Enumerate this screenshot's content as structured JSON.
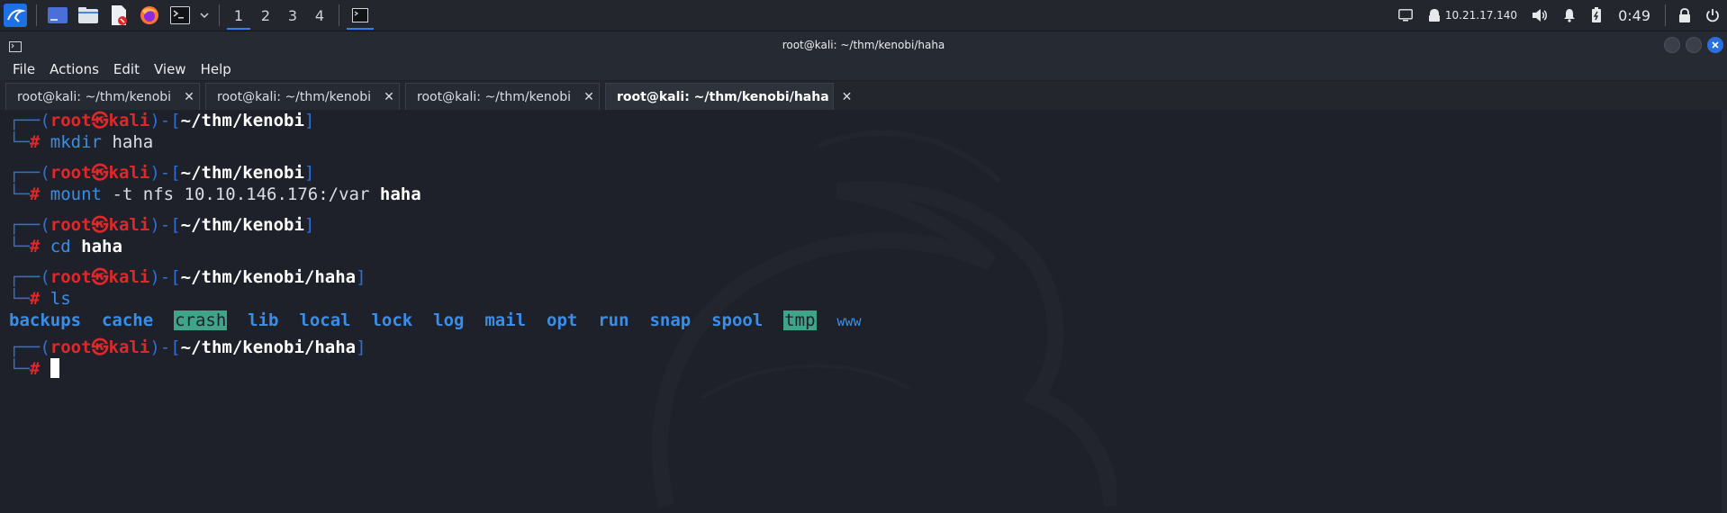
{
  "panel": {
    "workspaces": [
      "1",
      "2",
      "3",
      "4"
    ],
    "active_workspace": "1",
    "ip": "10.21.17.140",
    "clock": "0:49",
    "icons": [
      "kali-menu-icon",
      "show-desktop-icon",
      "file-manager-icon",
      "text-editor-icon",
      "firefox-icon",
      "terminal-icon",
      "chevron-down-icon",
      "terminal-window-icon",
      "screen-icon",
      "network-icon",
      "volume-icon",
      "notifications-icon",
      "battery-icon",
      "lock-icon",
      "power-icon"
    ]
  },
  "window": {
    "title": "root@kali: ~/thm/kenobi/haha",
    "menu": [
      "File",
      "Actions",
      "Edit",
      "View",
      "Help"
    ],
    "tabs": [
      {
        "label": "root@kali: ~/thm/kenobi",
        "close": "✕"
      },
      {
        "label": "root@kali: ~/thm/kenobi",
        "close": "✕"
      },
      {
        "label": "root@kali: ~/thm/kenobi",
        "close": "✕"
      },
      {
        "label": "root@kali: ~/thm/kenobi/haha",
        "close": "✕"
      }
    ],
    "active_tab": 3
  },
  "terminal": {
    "prompt_user": "root",
    "prompt_sep": "㉿",
    "prompt_host": "kali",
    "prompt_char": "#",
    "blocks": [
      {
        "path": "~/thm/kenobi",
        "cmd": "mkdir",
        "args": "haha",
        "args_bold": ""
      },
      {
        "path": "~/thm/kenobi",
        "cmd": "mount",
        "args": "-t nfs 10.10.146.176:/var",
        "args_bold": "haha"
      },
      {
        "path": "~/thm/kenobi",
        "cmd": "cd",
        "args": "",
        "args_bold": "haha"
      },
      {
        "path": "~/thm/kenobi/haha",
        "cmd": "ls",
        "args": "",
        "args_bold": ""
      }
    ],
    "ls_output": [
      "backups",
      "cache",
      "crash",
      "lib",
      "local",
      "lock",
      "log",
      "mail",
      "opt",
      "run",
      "snap",
      "spool",
      "tmp",
      "www"
    ],
    "last_prompt_path": "~/thm/kenobi/haha"
  },
  "colors": {
    "accent": "#367bf0",
    "prompt_red": "#e0282a",
    "prompt_blue": "#2d6fd6",
    "dir_blue": "#3a8ee8",
    "highlight_green": "#40a48a"
  }
}
